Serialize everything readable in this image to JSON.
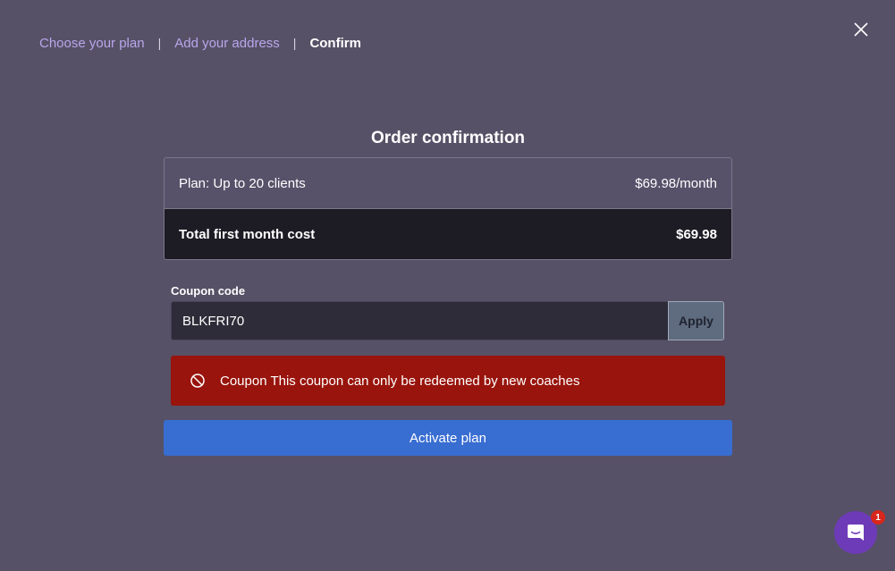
{
  "steps": [
    {
      "label": "Choose your plan"
    },
    {
      "label": "Add your address"
    },
    {
      "label": "Confirm"
    }
  ],
  "step_separator": "|",
  "order": {
    "title": "Order confirmation",
    "plan_label": "Plan: Up to 20 clients",
    "plan_price": "$69.98/month",
    "total_label": "Total first month cost",
    "total_value": "$69.98"
  },
  "coupon": {
    "label": "Coupon code",
    "value": "BLKFRI70",
    "apply_label": "Apply"
  },
  "error": {
    "message": "Coupon This coupon can only be redeemed by new coaches",
    "color": "#98140c"
  },
  "activate_label": "Activate plan",
  "chat": {
    "badge_count": "1"
  },
  "icons": {
    "close": "close-icon",
    "error": "ban-icon",
    "chat": "chat-icon"
  },
  "colors": {
    "background": "#565166",
    "accent_link": "#b9a6ec",
    "primary_button": "#386dd1",
    "chat_launcher": "#6e3bb8",
    "badge": "#d8271c"
  }
}
